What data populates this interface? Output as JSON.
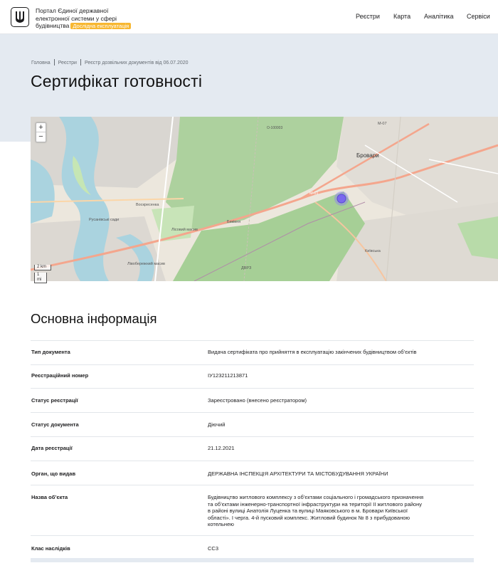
{
  "header": {
    "logo_line1": "Портал Єдиної державної",
    "logo_line2": "електронної системи у сфері",
    "logo_line3": "будівництва",
    "beta_badge": "Дослідна експлуатація",
    "nav": [
      "Реєстри",
      "Карта",
      "Аналітика",
      "Сервіси"
    ]
  },
  "breadcrumbs": [
    "Головна",
    "Реєстри",
    "Реєстр дозвільних документів від 06.07.2020"
  ],
  "page_title": "Сертифікат готовності",
  "map": {
    "zoom_in": "+",
    "zoom_out": "−",
    "scale_km": "2 km",
    "scale_mi": "1 mi",
    "labels": {
      "brovary": "Бровари",
      "road_m01": "М-01",
      "road_m07": "М-07",
      "road_o100": "О-100003",
      "voskresenka": "Воскресенка",
      "rusanivski": "Русанівські сади",
      "lisovyi": "Лісовий масив",
      "bykivnia": "Биківня",
      "livoberezhnyi": "Лівобережний масив",
      "dvrz": "ДВРЗ",
      "kyivska": "Київська"
    }
  },
  "section_title": "Основна інформація",
  "rows": [
    {
      "key": "Тип документа",
      "value": "Видача сертифіката про прийняття в експлуатацію закінчених будівництвом об’єктів"
    },
    {
      "key": "Реєстраційний номер",
      "value": "ІУ123211213871"
    },
    {
      "key": "Статус реєстрації",
      "value": "Зареєстровано (внесено реєстратором)"
    },
    {
      "key": "Статус документа",
      "value": "Діючий"
    },
    {
      "key": "Дата реєстрації",
      "value": "21.12.2021"
    },
    {
      "key": "Орган, що видав",
      "value": "ДЕРЖАВНА ІНСПЕКЦІЯ АРХІТЕКТУРИ ТА МІСТОБУДУВАННЯ УКРАЇНИ"
    },
    {
      "key": "Назва об’єкта",
      "value_lines": [
        "Будівництво житлового комплексу з об’єктами соціального і громадського призначення",
        "та об’єктами інженерно-транспортної інфраструктури на території ІІ житлового району",
        "в районі вулиці Анатолія Луценка та вулиці Маяковського в м. Бровари Київської",
        "області». І черга. 4-й пусковий комплекс. Житловий будинок № 8 з прибудованою",
        "котельнею"
      ]
    },
    {
      "key": "Клас наслідків",
      "value": "СС3"
    }
  ],
  "colors": {
    "hero_bg": "#e4eaf1",
    "beta_badge": "#f7b731",
    "map_marker": "#7b68ee",
    "forest": "#a9d49a",
    "water": "#aad3df",
    "road": "#f7a08a"
  }
}
